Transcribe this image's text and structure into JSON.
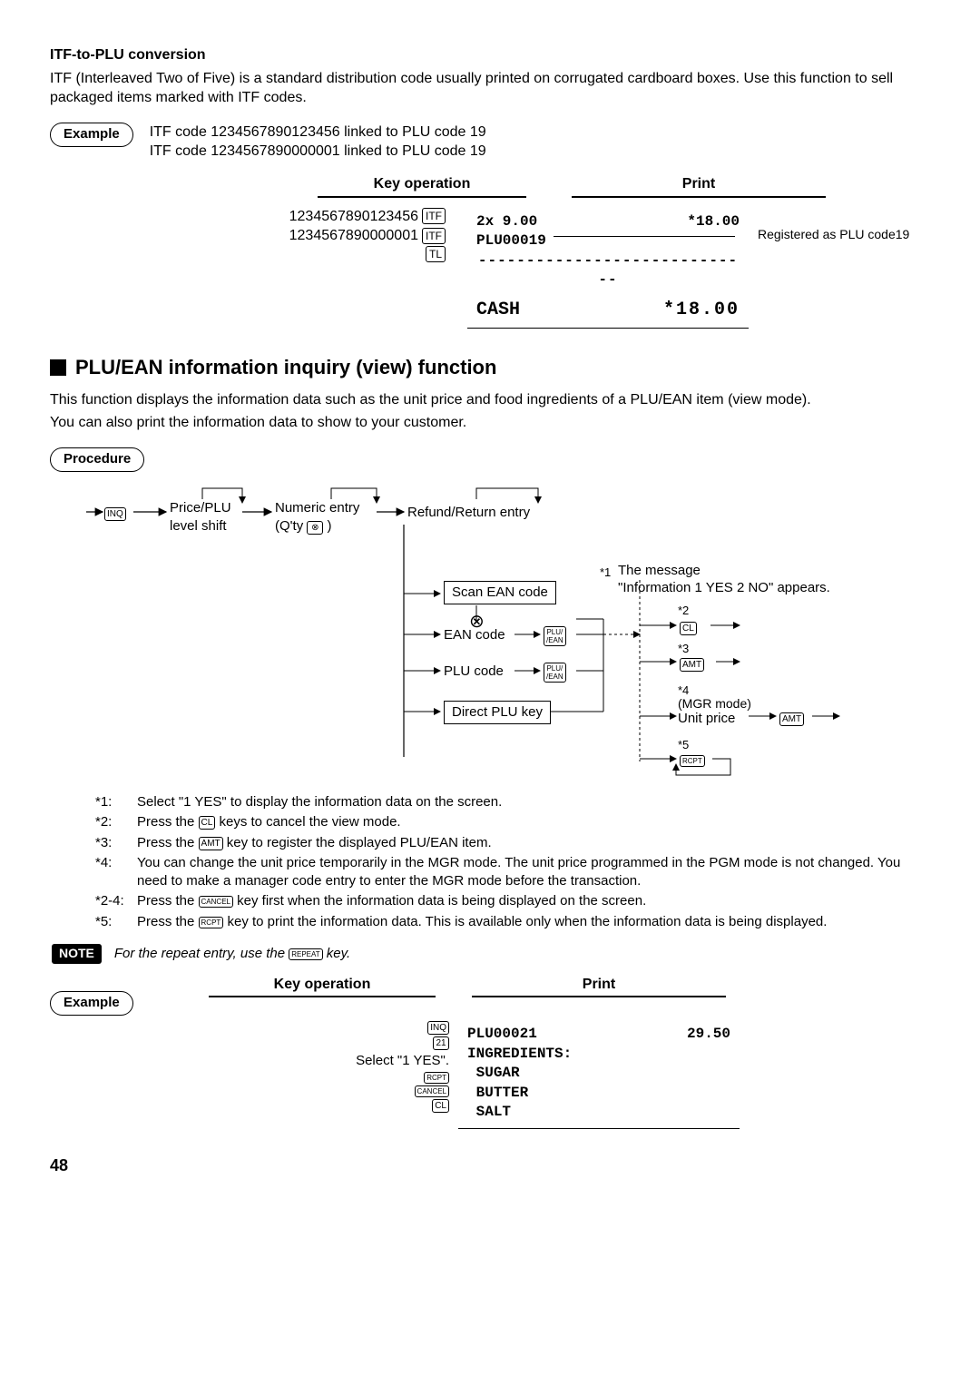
{
  "itf": {
    "title": "ITF-to-PLU conversion",
    "p1": "ITF (Interleaved Two of Five) is a standard distribution code usually printed on corrugated cardboard boxes. Use this function to sell packaged items marked with ITF codes.",
    "example_label": "Example",
    "ex_line1": "ITF code 1234567890123456 linked to PLU code 19",
    "ex_line2": "ITF code 1234567890000001 linked to PLU code 19",
    "head_keyop": "Key operation",
    "head_print": "Print",
    "key_num1": "1234567890123456",
    "key_num2": "1234567890000001",
    "key_itf": "ITF",
    "key_tl": "TL",
    "receipt": {
      "l1a": "2x 9.00",
      "l1b": "*18.00",
      "l2": "PLU00019",
      "dash": "-----------------------------",
      "l3a": "CASH",
      "l3b": "*18.00"
    },
    "side": "Registered as PLU code19"
  },
  "inquiry": {
    "title": "PLU/EAN information inquiry (view) function",
    "p1": "This function displays the information data such as the unit price and food ingredients of a PLU/EAN item (view mode).",
    "p2": "You can also print the information data to show to your customer.",
    "procedure_label": "Procedure",
    "flow": {
      "inq": "INQ",
      "price": "Price/PLU",
      "level": "level shift",
      "numeric": "Numeric entry",
      "qty": "(Q'ty ",
      "mult": "⊗",
      "qty_end": " )",
      "refund": "Refund/Return entry",
      "scan": "Scan EAN code",
      "scan_icon": "⊗",
      "ean": "EAN code",
      "plu": "PLU code",
      "direct": "Direct PLU key",
      "plu_ean_key": "PLU/\n/EAN",
      "star1": "*1",
      "msg1": "The message",
      "msg2": "\"Information 1 YES 2 NO\" appears.",
      "star2": "*2",
      "cl": "CL",
      "star3": "*3",
      "amt": "AMT",
      "star4": "*4",
      "mgr": "(MGR mode)",
      "unit": "Unit price",
      "star5": "*5",
      "rcpt": "RCPT"
    },
    "notes": {
      "n1": {
        "label": "*1:",
        "text_a": "Select \"1 YES\" to display the information data on the screen."
      },
      "n2": {
        "label": "*2:",
        "text_a": "Press the ",
        "text_b": " keys to cancel the view mode.",
        "key": "CL"
      },
      "n3": {
        "label": "*3:",
        "text_a": "Press the ",
        "text_b": " key to register the displayed PLU/EAN item.",
        "key": "AMT"
      },
      "n4": {
        "label": "*4:",
        "text": "You can change the unit price temporarily in the MGR mode. The unit price programmed in the PGM mode is not changed. You need to make a manager code entry to enter the MGR mode before the transaction."
      },
      "n24": {
        "label": "*2-4:",
        "text_a": "Press the ",
        "text_b": " key first when the information data is being displayed on the screen.",
        "key": "CANCEL"
      },
      "n5": {
        "label": "*5:",
        "text_a": "Press the ",
        "text_b": " key to print the information data. This is available only when the information data is being displayed.",
        "key": "RCPT"
      }
    },
    "note_label": "NOTE",
    "note_text_a": "For the repeat entry, use the ",
    "note_key": "REPEAT",
    "note_text_b": " key.",
    "example2": {
      "label": "Example",
      "head_keyop": "Key operation",
      "head_print": "Print",
      "k_inq": "INQ",
      "k_21": "21",
      "k_select": "Select \"1 YES\".",
      "k_rcpt": "RCPT",
      "k_cancel": "CANCEL",
      "k_cl": "CL",
      "receipt": {
        "l1a": "PLU00021",
        "l1b": "29.50",
        "l2": "INGREDIENTS:",
        "l3": "SUGAR",
        "l4": "BUTTER",
        "l5": "SALT"
      }
    }
  },
  "page": "48"
}
